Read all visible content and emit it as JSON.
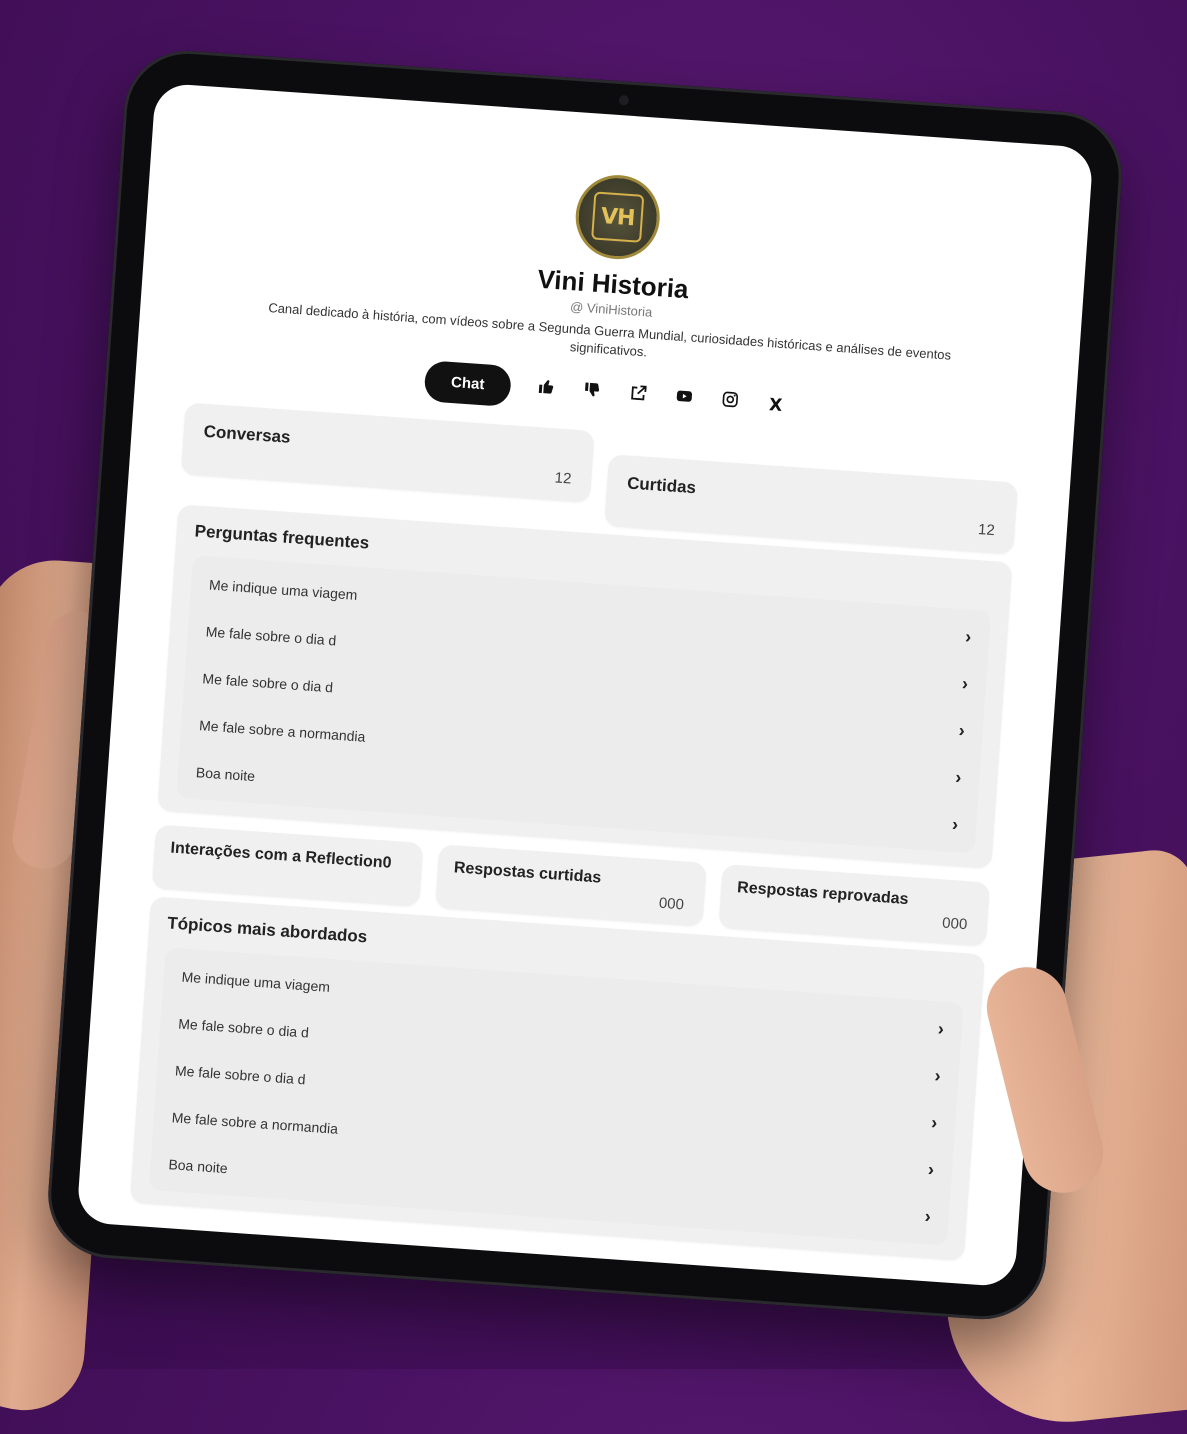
{
  "profile": {
    "avatar_text": "VH",
    "name": "Vini Historia",
    "handle": "@ ViniHistoria",
    "description": "Canal dedicado à história, com vídeos sobre a Segunda Guerra Mundial, curiosidades históricas e análises de eventos significativos."
  },
  "actions": {
    "chat_label": "Chat",
    "icons": [
      "thumbs-up-icon",
      "thumbs-down-icon",
      "external-link-icon",
      "youtube-icon",
      "instagram-icon",
      "x-icon"
    ],
    "x_label": "X"
  },
  "stats": {
    "conversas_label": "Conversas",
    "conversas_value": "12",
    "curtidas_label": "Curtidas",
    "curtidas_value": "12"
  },
  "faq": {
    "title": "Perguntas frequentes",
    "items": [
      "Me indique uma viagem",
      "Me fale sobre o dia d",
      "Me fale sobre o dia d",
      "Me fale sobre a normandia",
      "Boa noite"
    ]
  },
  "interactions": {
    "reflection_label": "Interações com a Reflection",
    "reflection_value": "0",
    "liked_label": "Respostas curtidas",
    "liked_value": "000",
    "rejected_label": "Respostas reprovadas",
    "rejected_value": "000"
  },
  "topics": {
    "title": "Tópicos mais abordados",
    "items": [
      "Me indique uma viagem",
      "Me fale sobre o dia d",
      "Me fale sobre o dia d",
      "Me fale sobre a normandia",
      "Boa noite"
    ]
  },
  "colors": {
    "background": "#4a1262",
    "button": "#111111",
    "card": "#f0f0f0",
    "avatar_gold": "#d4b14a"
  }
}
